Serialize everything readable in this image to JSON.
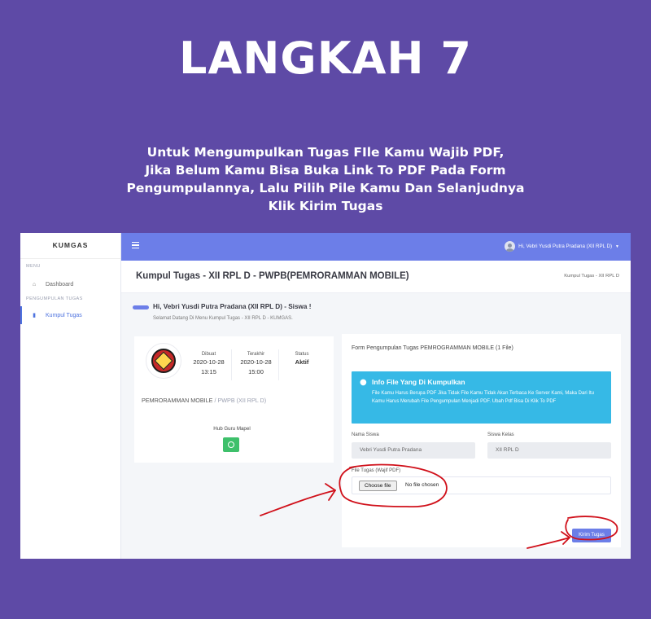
{
  "hero": {
    "title": "LANGKAH 7",
    "line1": "Untuk Mengumpulkan Tugas FIle Kamu Wajib PDF,",
    "line2": "Jika Belum Kamu Bisa Buka Link To PDF Pada Form",
    "line3": "Pengumpulannya, Lalu Pilih Pile Kamu Dan Selanjudnya",
    "line4": "Klik Kirim Tugas"
  },
  "sidebar": {
    "brand": "KUMGAS",
    "section_menu": "MENU",
    "section_kumpul": "PENGUMPULAN TUGAS",
    "items": [
      {
        "label": "Dashboard",
        "icon": "home-icon"
      },
      {
        "label": "Kumpul Tugas",
        "icon": "book-icon",
        "active": true
      }
    ]
  },
  "topbar": {
    "user": "Hi, Vebri Yusdi Putra Pradana (XII RPL D)"
  },
  "page": {
    "title": "Kumpul Tugas - XII RPL D - PWPB(PEMRORAMMAN MOBILE)",
    "breadcrumb": "Kumpul Tugas - XII RPL D"
  },
  "greeting": {
    "title": "Hi, Vebri Yusdi Putra Pradana (XII RPL D) - Siswa !",
    "subtitle": "Selamat Datang Di Menu Kumpul Tugas - XII RPL D - KUMGAS."
  },
  "task_card": {
    "stats": [
      {
        "label": "Dibuat",
        "date": "2020-10-28",
        "time": "13:15"
      },
      {
        "label": "Terakhir",
        "date": "2020-10-28",
        "time": "15:00"
      },
      {
        "label": "Status",
        "date": "Aktif",
        "time": ""
      }
    ],
    "course": "PEMRORAMMAN MOBILE",
    "course_sep": "/",
    "course_code": "PWPB (XII RPL D)",
    "hub_label": "Hub Guru Mapel"
  },
  "form": {
    "title": "Form Pengumpulan Tugas PEMROGRAMMAN MOBILE (1 File)",
    "info_title": "Info File Yang Di Kumpulkan",
    "info_text": "File Kamu Harus Berupa PDF Jika Tidak File Kamu Tidak Akan Terbaca Ke Server Kami, Maka Dari Itu Kamu Harus Merubah File Pengumpulan Menjadi PDF. Ubah Pdf Bisa Di Klik To PDF",
    "name_label": "Nama Siswa",
    "name_value": "Vebri Yusdi Putra Pradana",
    "class_label": "Siswa Kelas",
    "class_value": "XII RPL D",
    "file_label": "File Tugas (Wajif PDF)",
    "choose_label": "Choose file",
    "no_file": "No file chosen",
    "submit_label": "Kirim Tugas"
  },
  "colors": {
    "background": "#5e4aa6",
    "primary": "#6c7ee8",
    "info": "#36b9e6",
    "whatsapp": "#3ec06b",
    "annotation": "#d0101a"
  }
}
